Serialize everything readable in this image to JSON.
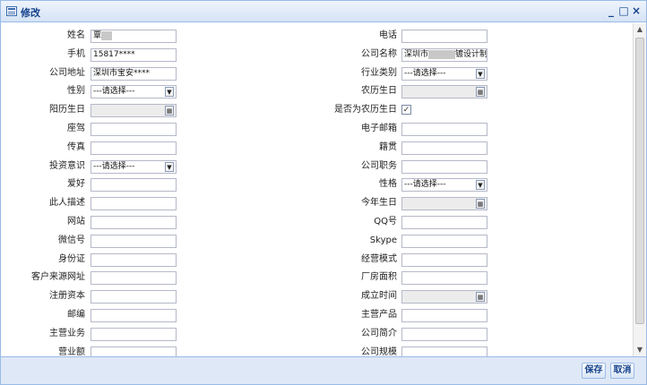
{
  "window": {
    "title": "修改",
    "controls": [
      "_",
      "□",
      "×"
    ]
  },
  "left_fields": [
    {
      "label": "姓名",
      "type": "text",
      "value": "覃",
      "blurred": true
    },
    {
      "label": "手机",
      "type": "text",
      "value": "15817****"
    },
    {
      "label": "公司地址",
      "type": "text",
      "value": "深圳市宝安****"
    },
    {
      "label": "性别",
      "type": "select",
      "value": "---请选择---"
    },
    {
      "label": "阳历生日",
      "type": "date",
      "value": "",
      "disabled": true
    },
    {
      "label": "座驾",
      "type": "text",
      "value": ""
    },
    {
      "label": "传真",
      "type": "text",
      "value": ""
    },
    {
      "label": "投资意识",
      "type": "select",
      "value": "---请选择---"
    },
    {
      "label": "爱好",
      "type": "text",
      "value": ""
    },
    {
      "label": "此人描述",
      "type": "text",
      "value": ""
    },
    {
      "label": "网站",
      "type": "text",
      "value": ""
    },
    {
      "label": "微信号",
      "type": "text",
      "value": ""
    },
    {
      "label": "身份证",
      "type": "text",
      "value": ""
    },
    {
      "label": "客户来源网址",
      "type": "text",
      "value": ""
    },
    {
      "label": "注册资本",
      "type": "text",
      "value": ""
    },
    {
      "label": "邮编",
      "type": "text",
      "value": ""
    },
    {
      "label": "主营业务",
      "type": "text",
      "value": ""
    },
    {
      "label": "营业额",
      "type": "text",
      "value": ""
    }
  ],
  "right_fields": [
    {
      "label": "电话",
      "type": "text",
      "value": ""
    },
    {
      "label": "公司名称",
      "type": "text",
      "value": "深圳市",
      "suffix": "镀设计制",
      "blurred": true
    },
    {
      "label": "行业类别",
      "type": "select",
      "value": "---请选择---"
    },
    {
      "label": "农历生日",
      "type": "date",
      "value": "",
      "disabled": true
    },
    {
      "label": "是否为农历生日",
      "type": "checkbox",
      "checked": true,
      "mark": "✓"
    },
    {
      "label": "电子邮箱",
      "type": "text",
      "value": ""
    },
    {
      "label": "籍贯",
      "type": "text",
      "value": ""
    },
    {
      "label": "公司职务",
      "type": "text",
      "value": ""
    },
    {
      "label": "性格",
      "type": "select",
      "value": "---请选择---"
    },
    {
      "label": "今年生日",
      "type": "date",
      "value": "",
      "disabled": true
    },
    {
      "label": "QQ号",
      "type": "text",
      "value": ""
    },
    {
      "label": "Skype",
      "type": "text",
      "value": ""
    },
    {
      "label": "经营模式",
      "type": "text",
      "value": ""
    },
    {
      "label": "厂房面积",
      "type": "text",
      "value": ""
    },
    {
      "label": "成立时间",
      "type": "date",
      "value": "",
      "disabled": true
    },
    {
      "label": "主营产品",
      "type": "text",
      "value": ""
    },
    {
      "label": "公司简介",
      "type": "text",
      "value": ""
    },
    {
      "label": "公司规模",
      "type": "text",
      "value": ""
    }
  ],
  "footer": {
    "save_label": "保存",
    "cancel_label": "取消"
  },
  "colors": {
    "title_text": "#15428b",
    "border": "#99bbe8",
    "footer_bg": "#dfe8f6"
  },
  "icons": {
    "window_icon": "form-icon",
    "select_arrow": "chevron-down-icon",
    "calendar": "calendar-icon"
  }
}
